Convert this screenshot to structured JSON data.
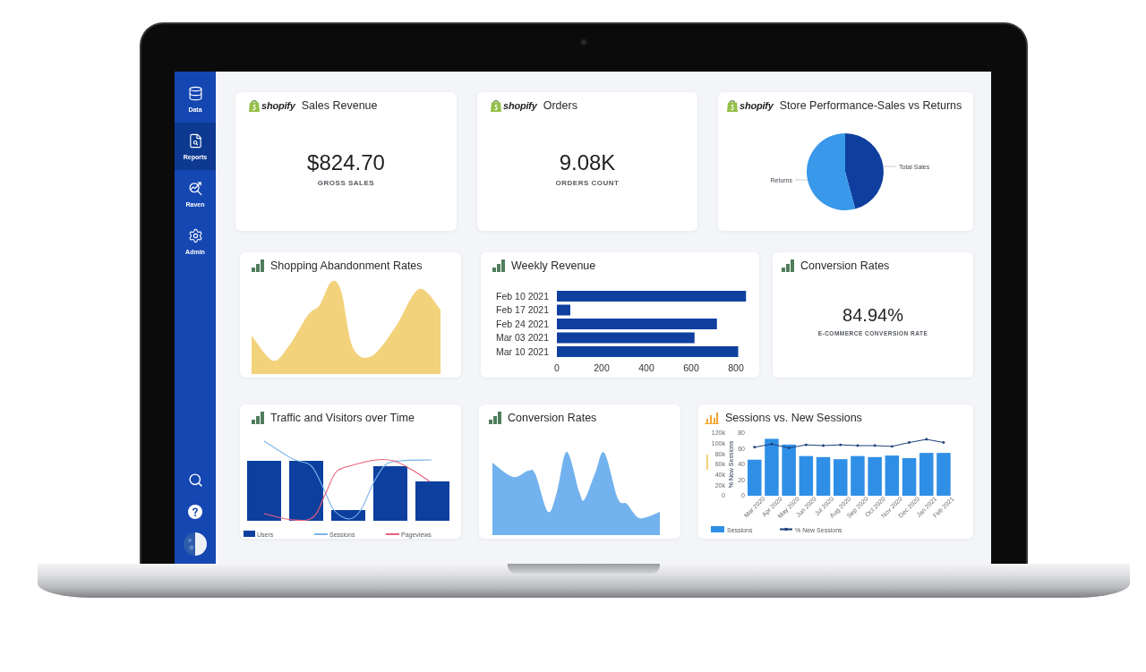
{
  "sidebar": {
    "nav": [
      {
        "label": "Data",
        "selected": false
      },
      {
        "label": "Reports",
        "selected": true
      },
      {
        "label": "Raven",
        "selected": false
      },
      {
        "label": "Admin",
        "selected": false
      }
    ]
  },
  "rows": [
    {
      "cards": [
        {
          "kind": "metric",
          "brand": "shopify",
          "title": "Sales Revenue",
          "value": "$824.70",
          "caption": "GROSS SALES"
        },
        {
          "kind": "metric",
          "brand": "shopify",
          "title": "Orders",
          "value": "9.08K",
          "caption": "ORDERS COUNT"
        },
        {
          "kind": "pie",
          "brand": "shopify",
          "title": "Store Performance-Sales vs Returns",
          "slices": [
            {
              "label": "Total Sales",
              "color": "#0e3f9e"
            },
            {
              "label": "Returns",
              "color": "#3a98ea"
            }
          ]
        }
      ]
    },
    {
      "cards": [
        {
          "kind": "area",
          "title": "Shopping Abandonment Rates",
          "color": "#f3d27c"
        },
        {
          "kind": "hbar",
          "title": "Weekly Revenue",
          "chart_data": {
            "type": "bar",
            "orientation": "horizontal",
            "categories": [
              "Feb 10 2021",
              "Feb 17 2021",
              "Feb 24 2021",
              "Mar 03 2021",
              "Mar 10 2021"
            ],
            "values": [
              845,
              60,
              715,
              615,
              810
            ],
            "xlim": [
              0,
              850
            ],
            "xticks": [
              0,
              200,
              400,
              600,
              800
            ]
          }
        },
        {
          "kind": "metric",
          "title": "Conversion Rates",
          "value": "84.94%",
          "caption": "E-COMMERCE CONVERSION RATE"
        }
      ]
    },
    {
      "cards": [
        {
          "kind": "traffic",
          "title": "Traffic and Visitors over Time",
          "legend": [
            {
              "label": "Users",
              "kind": "bar",
              "color": "#0d3f9f"
            },
            {
              "label": "Sessions",
              "kind": "line",
              "color": "#7ab6ea"
            },
            {
              "label": "Pageviews",
              "kind": "line",
              "color": "#e8607a"
            }
          ]
        },
        {
          "kind": "area",
          "title": "Conversion Rates",
          "color": "#72b2ee"
        },
        {
          "kind": "combo",
          "title": "Sessions vs. New Sessions",
          "layers": [
            {
              "chart_data": {
                "type": "bar",
                "categories": [
                  "Mar 2020",
                  "Apr 2020",
                  "May 2020",
                  "Jun 2020",
                  "Jul 2020",
                  "Aug 2020",
                  "Sep 2020",
                  "Oct 2020",
                  "Nov 2020",
                  "Dec 2020",
                  "Jan 2021",
                  "Feb 2021"
                ],
                "series": [
                  {
                    "name": "Sessions",
                    "color": "#2f8fe6",
                    "values": [
                      69000,
                      109000,
                      98000,
                      76000,
                      74000,
                      70000,
                      76000,
                      74000,
                      77000,
                      72000,
                      82000,
                      82000
                    ]
                  }
                ],
                "ylim": [
                  0,
                  120000
                ],
                "yticks": [
                  {
                    "value": 0,
                    "label": "0"
                  },
                  {
                    "value": 20000,
                    "label": "20k"
                  },
                  {
                    "value": 40000,
                    "label": "40k"
                  },
                  {
                    "value": 60000,
                    "label": "60k"
                  },
                  {
                    "value": 80000,
                    "label": "80k"
                  },
                  {
                    "value": 100000,
                    "label": "100k"
                  },
                  {
                    "value": 120000,
                    "label": "120k"
                  }
                ]
              }
            },
            {
              "chart_data": {
                "type": "line",
                "ylabel": "% New Sessions",
                "series": [
                  {
                    "name": "% New Sessions",
                    "color": "#1b3f7a",
                    "values": [
                      62,
                      66,
                      61,
                      65,
                      64,
                      65,
                      64,
                      64,
                      63,
                      68,
                      72,
                      68
                    ]
                  }
                ],
                "ylim": [
                  0,
                  80
                ],
                "yticks": [
                  0,
                  20,
                  40,
                  60,
                  80
                ]
              }
            }
          ]
        }
      ]
    }
  ]
}
